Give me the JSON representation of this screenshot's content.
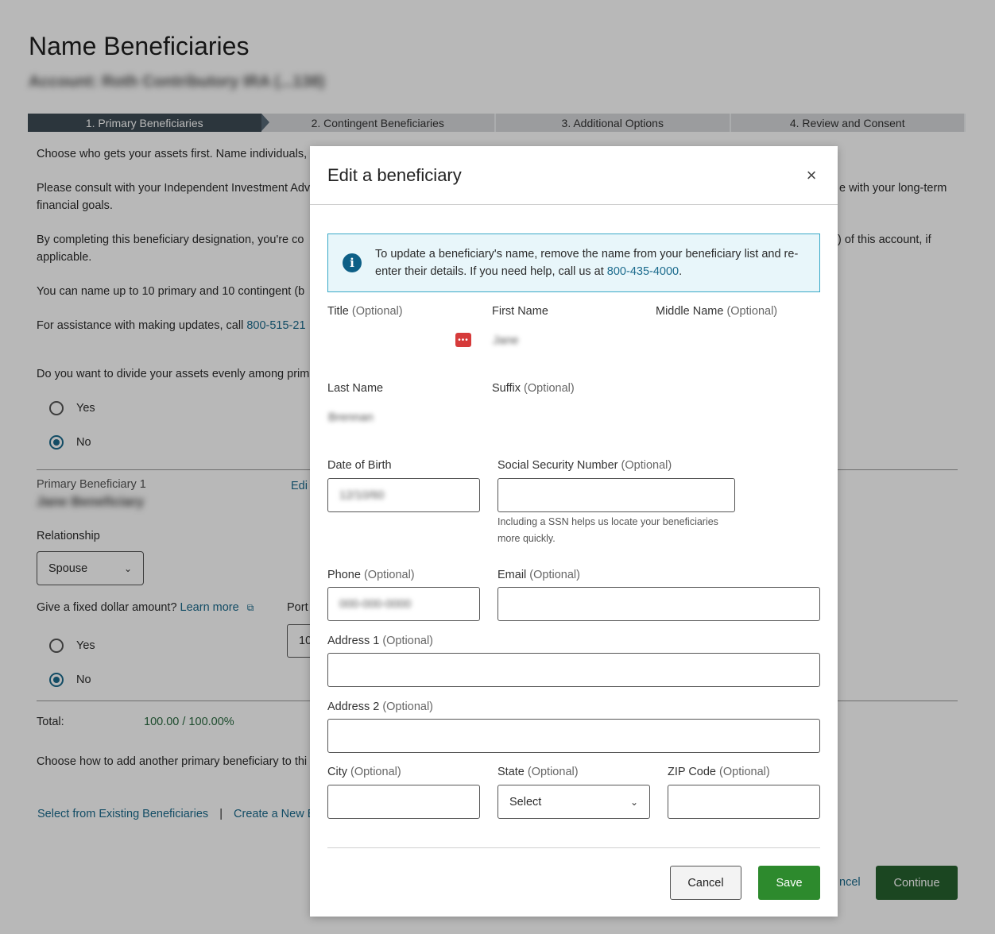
{
  "page": {
    "title": "Name Beneficiaries",
    "subtitle": "Account: Roth Contributory IRA (...138)",
    "steps": [
      {
        "label": "1. Primary Beneficiaries"
      },
      {
        "label": "2. Contingent Beneficiaries"
      },
      {
        "label": "3. Additional Options"
      },
      {
        "label": "4. Review and Consent"
      }
    ],
    "para1": "Choose who gets your assets first. Name individuals,",
    "para2a": "Please consult with your Independent Investment Adv",
    "para2b": "e with your long-term",
    "para2c": "financial goals.",
    "para3a": "By completing this beneficiary designation, you're co",
    "para3b": ") of this account, if",
    "para3c": "applicable.",
    "para4": "You can name up to 10 primary and 10 contingent (b",
    "para5_text": "For assistance with making updates, call ",
    "para5_phone": "800-515-21",
    "divide_question": "Do you want to divide your assets evenly among prim",
    "yes": "Yes",
    "no": "No",
    "primary_label": "Primary Beneficiary 1",
    "primary_name": "Jane Beneficiary",
    "edit_link": "Edi",
    "relationship_label": "Relationship",
    "relationship_value": "Spouse",
    "fixed_question": "Give a fixed dollar amount?",
    "learn_more": "Learn more",
    "portion_label": "Port",
    "portion_value": "10",
    "total_label": "Total:",
    "total_value": "100.00 / 100.00%",
    "choose_how": "Choose how to add another primary beneficiary to thi",
    "select_existing": "Select from Existing Beneficiaries",
    "separator": "|",
    "create_new": "Create a New B",
    "cancel_partial": "ncel",
    "continue": "Continue"
  },
  "modal": {
    "title": "Edit a beneficiary",
    "close": "×",
    "info_text": "To update a beneficiary's name, remove the name from your beneficiary list and re-enter their details. If you need help, call us at ",
    "info_phone": "800-435-4000",
    "info_end": ".",
    "title_label": "Title",
    "optional": "(Optional)",
    "first_name_label": "First Name",
    "first_name_value": "Jane",
    "middle_name_label": "Middle Name",
    "last_name_label": "Last Name",
    "last_name_value": "Brennan",
    "suffix_label": "Suffix",
    "dob_label": "Date of Birth",
    "dob_value": "12/10/60",
    "ssn_label": "Social Security Number",
    "ssn_help": "Including a SSN helps us locate your beneficiaries more quickly.",
    "phone_label": "Phone",
    "phone_value": "000-000-0000",
    "email_label": "Email",
    "address1_label": "Address 1",
    "address2_label": "Address 2",
    "city_label": "City",
    "state_label": "State",
    "state_value": "Select",
    "zip_label": "ZIP Code",
    "cancel": "Cancel",
    "save": "Save"
  }
}
